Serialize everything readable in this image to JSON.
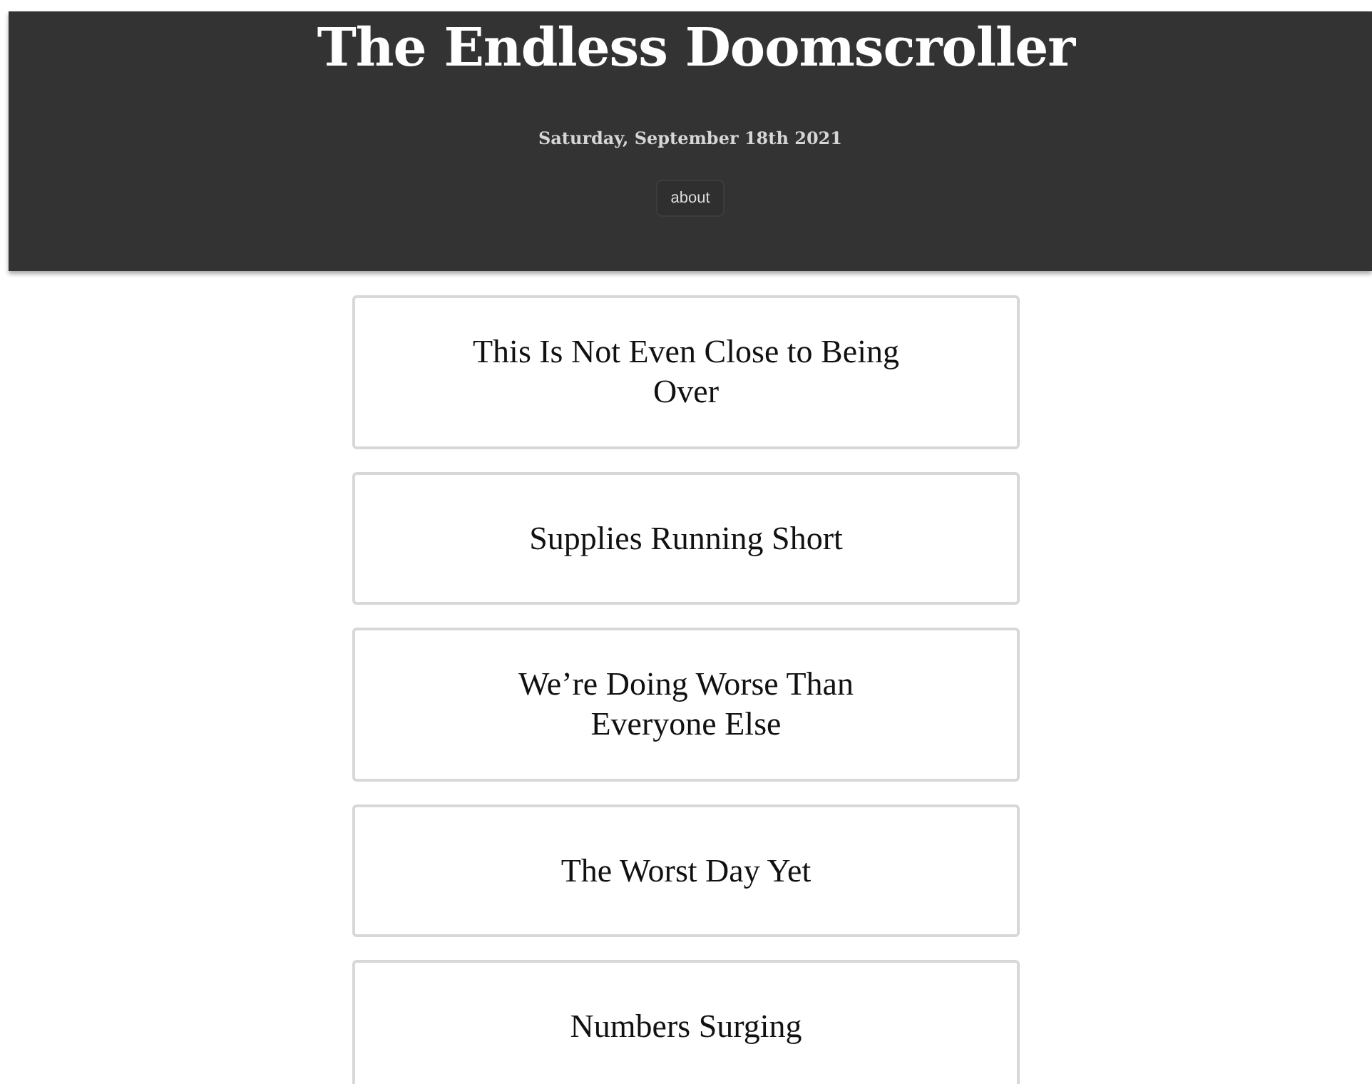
{
  "header": {
    "title": "The Endless Doomscroller",
    "date": "Saturday, September 18th 2021",
    "button": "about"
  },
  "headlines": [
    {
      "text": "This Is Not Even Close to Being Over"
    },
    {
      "text": "Supplies Running Short"
    },
    {
      "text": "We’re Doing Worse Than Everyone Else"
    },
    {
      "text": "The Worst Day Yet"
    },
    {
      "text": "Numbers Surging"
    }
  ]
}
